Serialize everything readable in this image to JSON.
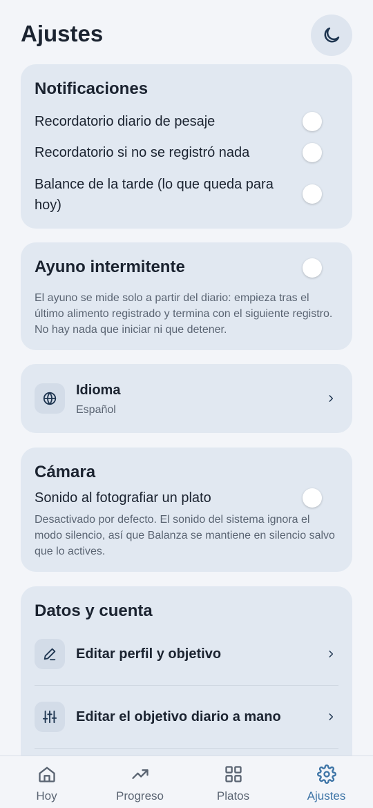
{
  "header": {
    "title": "Ajustes",
    "theme_icon": "moon-icon"
  },
  "notifications": {
    "title": "Notificaciones",
    "items": [
      {
        "label": "Recordatorio diario de pesaje",
        "enabled": false
      },
      {
        "label": "Recordatorio si no se registró nada",
        "enabled": false
      },
      {
        "label": "Balance de la tarde (lo que queda para hoy)",
        "enabled": false
      }
    ]
  },
  "fasting": {
    "title": "Ayuno intermitente",
    "enabled": false,
    "description": "El ayuno se mide solo a partir del diario: empieza tras el último alimento registrado y termina con el siguiente registro. No hay nada que iniciar ni que detener."
  },
  "language": {
    "title": "Idioma",
    "value": "Español",
    "icon": "globe-icon"
  },
  "camera": {
    "title": "Cámara",
    "sound_label": "Sonido al fotografiar un plato",
    "enabled": false,
    "description": "Desactivado por defecto. El sonido del sistema ignora el modo silencio, así que Balanza se mantiene en silencio salvo que lo actives."
  },
  "account": {
    "title": "Datos y cuenta",
    "items": [
      {
        "label": "Editar perfil y objetivo",
        "icon": "pencil-icon"
      },
      {
        "label": "Editar el objetivo diario a mano",
        "icon": "sliders-icon"
      }
    ]
  },
  "bottom_nav": {
    "tabs": [
      {
        "label": "Hoy",
        "icon": "home-icon"
      },
      {
        "label": "Progreso",
        "icon": "trending-up-icon"
      },
      {
        "label": "Platos",
        "icon": "grid-icon"
      },
      {
        "label": "Ajustes",
        "icon": "gear-icon",
        "active": true
      }
    ]
  },
  "colors": {
    "accent": "#3d74a6",
    "card": "#e1e8f1",
    "background": "#f3f5f9",
    "text": "#1b2330"
  }
}
